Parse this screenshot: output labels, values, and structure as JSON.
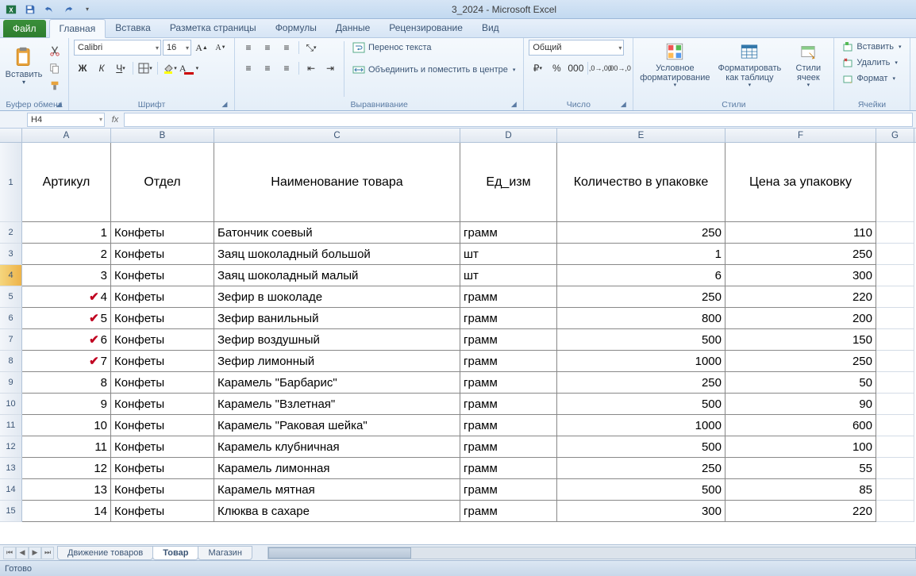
{
  "title": "3_2024 - Microsoft Excel",
  "qat": {
    "save": "save-icon",
    "undo": "undo-icon",
    "redo": "redo-icon"
  },
  "tabs": {
    "file": "Файл",
    "items": [
      "Главная",
      "Вставка",
      "Разметка страницы",
      "Формулы",
      "Данные",
      "Рецензирование",
      "Вид"
    ],
    "active": 0
  },
  "ribbon": {
    "clipboard": {
      "label": "Буфер обмена",
      "paste": "Вставить"
    },
    "font": {
      "label": "Шрифт",
      "name": "Calibri",
      "size": "16"
    },
    "align": {
      "label": "Выравнивание",
      "wrap": "Перенос текста",
      "merge": "Объединить и поместить в центре"
    },
    "number": {
      "label": "Число",
      "format": "Общий"
    },
    "styles": {
      "label": "Стили",
      "cond": "Условное форматирование",
      "table": "Форматировать как таблицу",
      "cell": "Стили ячеек"
    },
    "cells": {
      "label": "Ячейки",
      "insert": "Вставить",
      "delete": "Удалить",
      "format": "Формат"
    }
  },
  "formula_bar": {
    "namebox": "H4",
    "fx": "fx"
  },
  "columns": [
    "A",
    "B",
    "C",
    "D",
    "E",
    "F",
    "G"
  ],
  "headers": [
    "Артикул",
    "Отдел",
    "Наименование товара",
    "Ед_изм",
    "Количество в упаковке",
    "Цена за упаковку"
  ],
  "active_row": 4,
  "marks": {
    "5": "✔",
    "6": "✔",
    "7": "✔",
    "8": "✔"
  },
  "rows": [
    {
      "a": "1",
      "b": "Конфеты",
      "c": "Батончик соевый",
      "d": "грамм",
      "e": "250",
      "f": "110"
    },
    {
      "a": "2",
      "b": "Конфеты",
      "c": "Заяц шоколадный большой",
      "d": "шт",
      "e": "1",
      "f": "250"
    },
    {
      "a": "3",
      "b": "Конфеты",
      "c": "Заяц шоколадный малый",
      "d": "шт",
      "e": "6",
      "f": "300"
    },
    {
      "a": "4",
      "b": "Конфеты",
      "c": "Зефир в шоколаде",
      "d": "грамм",
      "e": "250",
      "f": "220"
    },
    {
      "a": "5",
      "b": "Конфеты",
      "c": "Зефир ванильный",
      "d": "грамм",
      "e": "800",
      "f": "200"
    },
    {
      "a": "6",
      "b": "Конфеты",
      "c": "Зефир воздушный",
      "d": "грамм",
      "e": "500",
      "f": "150"
    },
    {
      "a": "7",
      "b": "Конфеты",
      "c": "Зефир лимонный",
      "d": "грамм",
      "e": "1000",
      "f": "250"
    },
    {
      "a": "8",
      "b": "Конфеты",
      "c": "Карамель \"Барбарис\"",
      "d": "грамм",
      "e": "250",
      "f": "50"
    },
    {
      "a": "9",
      "b": "Конфеты",
      "c": "Карамель \"Взлетная\"",
      "d": "грамм",
      "e": "500",
      "f": "90"
    },
    {
      "a": "10",
      "b": "Конфеты",
      "c": "Карамель \"Раковая шейка\"",
      "d": "грамм",
      "e": "1000",
      "f": "600"
    },
    {
      "a": "11",
      "b": "Конфеты",
      "c": "Карамель клубничная",
      "d": "грамм",
      "e": "500",
      "f": "100"
    },
    {
      "a": "12",
      "b": "Конфеты",
      "c": "Карамель лимонная",
      "d": "грамм",
      "e": "250",
      "f": "55"
    },
    {
      "a": "13",
      "b": "Конфеты",
      "c": "Карамель мятная",
      "d": "грамм",
      "e": "500",
      "f": "85"
    },
    {
      "a": "14",
      "b": "Конфеты",
      "c": "Клюква в сахаре",
      "d": "грамм",
      "e": "300",
      "f": "220"
    }
  ],
  "sheets": {
    "items": [
      "Движение товаров",
      "Товар",
      "Магазин"
    ],
    "active": 1
  },
  "status": "Готово"
}
